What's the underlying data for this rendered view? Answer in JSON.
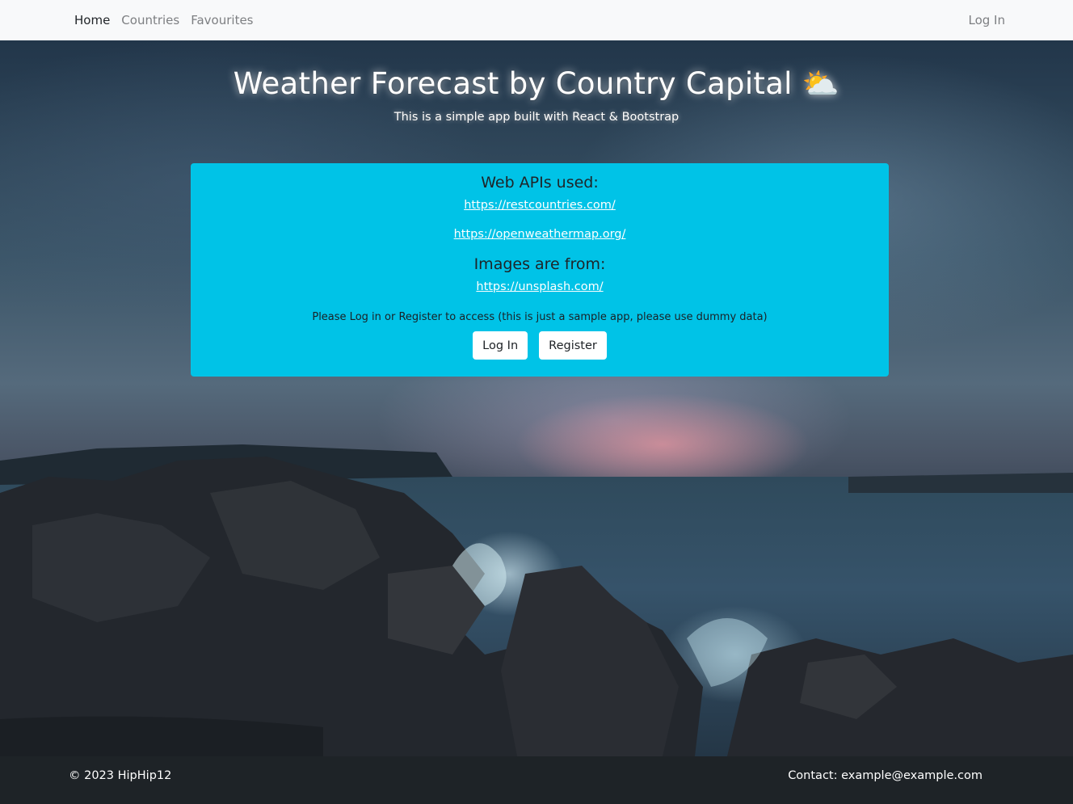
{
  "nav": {
    "links": [
      {
        "label": "Home"
      },
      {
        "label": "Countries"
      },
      {
        "label": "Favourites"
      }
    ],
    "login_label": "Log In"
  },
  "hero": {
    "title": "Weather Forecast by Country Capital",
    "title_emoji": "⛅",
    "subtitle": "This is a simple app built with React & Bootstrap"
  },
  "card": {
    "apis_heading": "Web APIs used:",
    "api_links": [
      "https://restcountries.com/",
      "https://openweathermap.org/"
    ],
    "images_heading": "Images are from:",
    "images_link": "https://unsplash.com/",
    "note": "Please Log in or Register to access (this is just a sample app, please use dummy data)",
    "login_button": "Log In",
    "register_button": "Register"
  },
  "footer": {
    "copyright": "© 2023 HipHip12",
    "contact": "Contact: example@example.com"
  },
  "colors": {
    "card_bg": "#00c3e7",
    "navbar_bg": "#f8f9fa",
    "footer_bg": "#1e2327"
  },
  "icons": {
    "weather": "sun-behind-cloud-icon"
  }
}
